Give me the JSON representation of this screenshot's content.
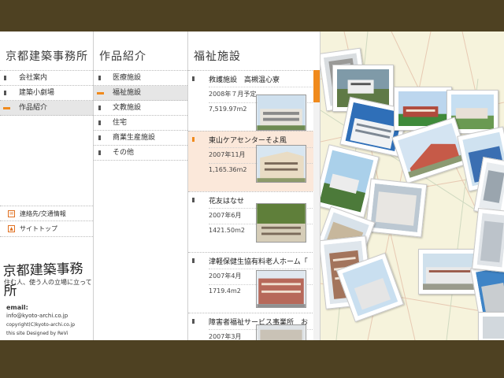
{
  "col1": {
    "title": "京都建築事務所",
    "menu": [
      "会社案内",
      "建築小劇場",
      "作品紹介"
    ],
    "links": [
      "連絡先/交通情報",
      "サイトトップ"
    ],
    "brand": "京都建築事務所",
    "tagline": "住む人、使う人の立場に立って",
    "email_label": "email:",
    "email": "info@kyoto-archi.co.jp",
    "copyright": "copyright(C)kyoto-archi.co.jp",
    "designed": "this site Designed by  ReVi"
  },
  "col2": {
    "title": "作品紹介",
    "menu": [
      "医療施設",
      "福祉施設",
      "文教施設",
      "住宅",
      "商業生産施設",
      "その他"
    ]
  },
  "col3": {
    "title": "福祉施設",
    "works": [
      {
        "title": "救護施設　高槻温心寮",
        "date": "2008年７月予定",
        "area": "7,519.97m2"
      },
      {
        "title": "東山ケアセンターそよ風",
        "date": "2007年11月",
        "area": "1,165.36m2"
      },
      {
        "title": "花友はなせ",
        "date": "2007年6月",
        "area": "1421.50m2"
      },
      {
        "title": "津軽保健生協有料老人ホーム「",
        "date": "2007年4月",
        "area": "1719.4m2"
      },
      {
        "title": "障害者福祉サービス事業所　お",
        "date": "2007年3月",
        "area": ""
      }
    ]
  },
  "colors": {
    "accent": "#f08a1c",
    "frame": "#4e4122",
    "collage_bg": "#f6f3dc"
  }
}
